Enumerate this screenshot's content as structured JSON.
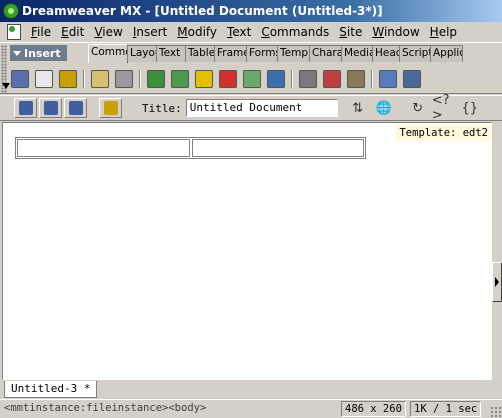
{
  "window": {
    "title": "Dreamweaver MX - [Untitled Document (Untitled-3*)]"
  },
  "menubar": {
    "items": [
      {
        "label": "File",
        "accel": "F"
      },
      {
        "label": "Edit",
        "accel": "E"
      },
      {
        "label": "View",
        "accel": "V"
      },
      {
        "label": "Insert",
        "accel": "I"
      },
      {
        "label": "Modify",
        "accel": "M"
      },
      {
        "label": "Text",
        "accel": "T"
      },
      {
        "label": "Commands",
        "accel": "C"
      },
      {
        "label": "Site",
        "accel": "S"
      },
      {
        "label": "Window",
        "accel": "W"
      },
      {
        "label": "Help",
        "accel": "H"
      }
    ]
  },
  "insert_panel": {
    "title": "Insert",
    "tabs": [
      {
        "label": "Common",
        "active": true
      },
      {
        "label": "Layout",
        "active": false
      },
      {
        "label": "Text",
        "active": false
      },
      {
        "label": "Tables",
        "active": false
      },
      {
        "label": "Frames",
        "active": false
      },
      {
        "label": "Forms",
        "active": false
      },
      {
        "label": "Templates",
        "active": false
      },
      {
        "label": "Characters",
        "active": false
      },
      {
        "label": "Media",
        "active": false
      },
      {
        "label": "Head",
        "active": false
      },
      {
        "label": "Script",
        "active": false
      },
      {
        "label": "Application",
        "active": false
      }
    ],
    "icons": [
      {
        "name": "hyperlink-icon",
        "color": "#5a6fb0"
      },
      {
        "name": "email-link-icon",
        "color": "#e8e8e8"
      },
      {
        "name": "named-anchor-icon",
        "color": "#c8a000"
      },
      {
        "name": "sep"
      },
      {
        "name": "table-icon",
        "color": "#d8c070"
      },
      {
        "name": "layer-icon",
        "color": "#9a9a9a"
      },
      {
        "name": "sep"
      },
      {
        "name": "image-icon",
        "color": "#3b8f3b"
      },
      {
        "name": "image-placeholder-icon",
        "color": "#4e9a4e"
      },
      {
        "name": "fireworks-html-icon",
        "color": "#e0c000"
      },
      {
        "name": "flash-icon",
        "color": "#d32f2f"
      },
      {
        "name": "rollover-image-icon",
        "color": "#6aa86a"
      },
      {
        "name": "navigation-bar-icon",
        "color": "#3d6fb0"
      },
      {
        "name": "sep"
      },
      {
        "name": "horizontal-rule-icon",
        "color": "#7a7a7a"
      },
      {
        "name": "date-icon",
        "color": "#c04040"
      },
      {
        "name": "tabular-data-icon",
        "color": "#8a7a5a"
      },
      {
        "name": "sep"
      },
      {
        "name": "comment-icon",
        "color": "#5a7ac0"
      },
      {
        "name": "tag-chooser-icon",
        "color": "#4a6a9a"
      }
    ]
  },
  "doc_toolbar": {
    "title_label": "Title:",
    "title_value": "Untitled Document",
    "buttons": [
      {
        "name": "code-view-icon",
        "color": "#3f5fa0"
      },
      {
        "name": "split-view-icon",
        "color": "#3f5fa0"
      },
      {
        "name": "design-view-icon",
        "color": "#3f5fa0"
      },
      {
        "name": "live-data-icon",
        "color": "#c8a000"
      }
    ],
    "right_icons": [
      {
        "name": "file-management-icon",
        "glyph": "⇅"
      },
      {
        "name": "preview-browser-icon",
        "glyph": "🌐"
      },
      {
        "name": "refresh-icon",
        "glyph": "↻"
      },
      {
        "name": "reference-icon",
        "glyph": "<?>"
      },
      {
        "name": "code-navigation-icon",
        "glyph": "{}"
      }
    ]
  },
  "document": {
    "template_label": "Template: edt2",
    "tab_label": "Untitled-3 *"
  },
  "statusbar": {
    "tag_selector": "<mmtinstance:fileinstance><body>",
    "window_size": "486 x 260",
    "download": "1K / 1 sec"
  }
}
